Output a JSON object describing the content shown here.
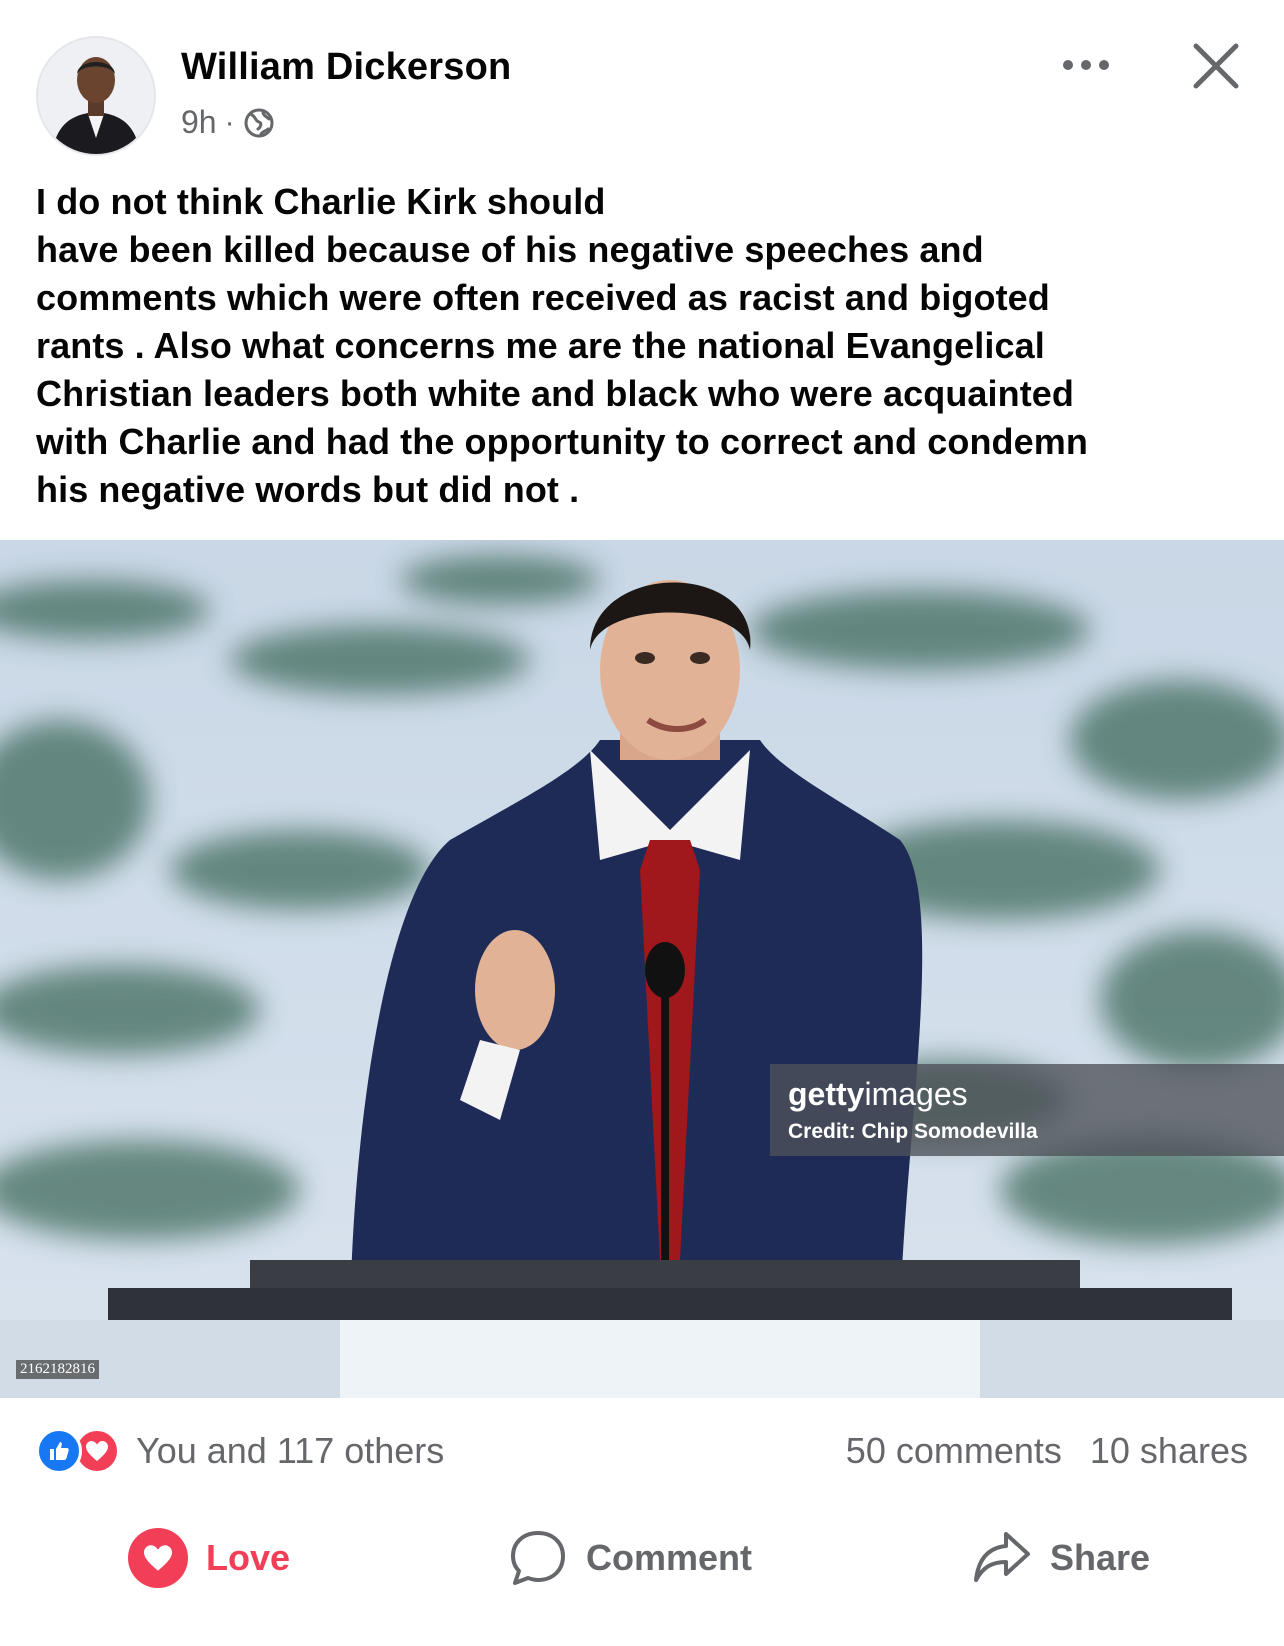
{
  "post": {
    "author": "William Dickerson",
    "time": "9h",
    "separator": "·",
    "privacy_icon": "globe-icon",
    "text": "I do not think Charlie Kirk should\nhave been killed because of his negative speeches and\ncomments which were often received as racist and bigoted\nrants . Also what concerns me  are the national Evangelical\nChristian leaders both white and black who were acquainted\nwith Charlie and had the opportunity to correct and condemn\nhis negative words but did not ."
  },
  "photo": {
    "watermark_brand_bold": "getty",
    "watermark_brand_light": "images",
    "watermark_credit": "Credit: Chip Somodevilla",
    "image_id": "2162182816"
  },
  "engagement": {
    "reactions_text": "You and 117 others",
    "comments": "50 comments",
    "shares": "10 shares"
  },
  "actions": {
    "love": "Love",
    "comment": "Comment",
    "share": "Share"
  },
  "colors": {
    "love": "#f33e58",
    "like": "#1877f2",
    "secondary_text": "#65676b"
  }
}
